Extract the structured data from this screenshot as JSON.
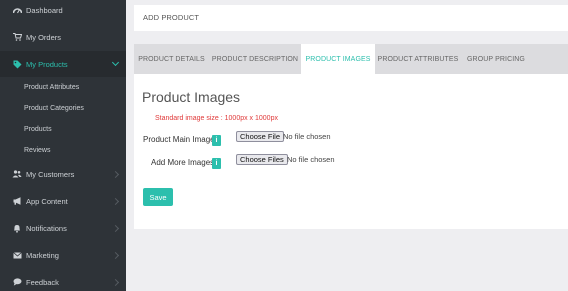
{
  "sidebar": {
    "items": [
      {
        "label": "Dashboard",
        "icon": "dashboard-icon"
      },
      {
        "label": "My Orders",
        "icon": "cart-icon"
      },
      {
        "label": "My Products",
        "icon": "tag-icon"
      },
      {
        "label": "My Customers",
        "icon": "users-icon"
      },
      {
        "label": "App Content",
        "icon": "megaphone-icon"
      },
      {
        "label": "Notifications",
        "icon": "bell-icon"
      },
      {
        "label": "Marketing",
        "icon": "mail-icon"
      },
      {
        "label": "Feedback",
        "icon": "comment-icon"
      }
    ],
    "subitems": [
      {
        "label": "Product Attributes"
      },
      {
        "label": "Product Categories"
      },
      {
        "label": "Products"
      },
      {
        "label": "Reviews"
      }
    ],
    "active_item": "My Products",
    "accent": "#2cbfad"
  },
  "header": {
    "title": "ADD PRODUCT"
  },
  "tabs": [
    {
      "label": "PRODUCT DETAILS"
    },
    {
      "label": "PRODUCT DESCRIPTION"
    },
    {
      "label": "PRODUCT IMAGES"
    },
    {
      "label": "PRODUCT ATTRIBUTES"
    },
    {
      "label": "GROUP PRICING"
    }
  ],
  "active_tab": "PRODUCT IMAGES",
  "panel": {
    "heading": "Product Images",
    "hint": "Standard image size : 1000px x 1000px",
    "main_image": {
      "label": "Product Main Image",
      "info": "i",
      "button": "Choose File",
      "status": "No file chosen"
    },
    "more_images": {
      "label": "Add More Images",
      "info": "i",
      "button": "Choose Files",
      "status": "No file chosen"
    },
    "save_label": "Save"
  },
  "colors": {
    "accent": "#2cbfad",
    "sidebar_bg": "#2e3338",
    "hint": "#e03a3a"
  }
}
